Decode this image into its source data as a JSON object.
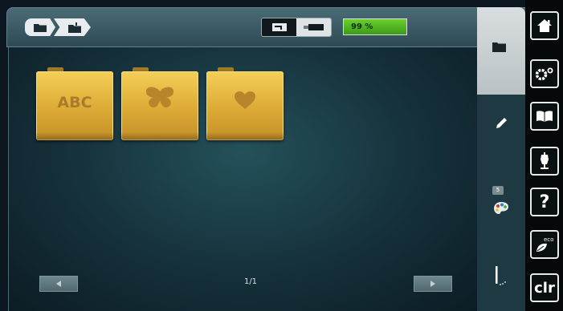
{
  "breadcrumb": {
    "root_icon": "folder-icon",
    "sub_icon": "sewing-folder-icon"
  },
  "status": {
    "mode_left_icon": "embroidery-hoop-icon",
    "mode_right_icon": "usb-stick-icon",
    "battery_text": "99 %",
    "battery_level": 0.99,
    "battery_color": "#4fb320"
  },
  "folders": [
    {
      "label": "ABC",
      "icon": "text-icon"
    },
    {
      "label": "",
      "icon": "butterfly-icon"
    },
    {
      "label": "",
      "icon": "heart-icon"
    }
  ],
  "pagination": {
    "page_text": "1/1",
    "prev_icon": "arrow-left-icon",
    "next_icon": "arrow-right-icon"
  },
  "side_tabs": [
    {
      "name": "folder",
      "icon": "folder-icon"
    },
    {
      "name": "edit",
      "icon": "pencil-icon"
    },
    {
      "name": "colors",
      "icon": "palette-icon",
      "badge": "5"
    },
    {
      "name": "stitch",
      "icon": "needle-icon"
    }
  ],
  "tools": [
    {
      "name": "home",
      "icon": "home-icon"
    },
    {
      "name": "setup",
      "icon": "gear-icon"
    },
    {
      "name": "tutorial",
      "icon": "book-icon"
    },
    {
      "name": "creative-consultant",
      "icon": "mannequin-icon"
    },
    {
      "name": "help",
      "icon": "question-icon",
      "text": "?"
    },
    {
      "name": "eco",
      "icon": "eco-leaf-icon",
      "text": "eco"
    },
    {
      "name": "clear",
      "icon": "clr-icon",
      "text": "clr"
    }
  ],
  "colors": {
    "folder_gold": "#e2b23d",
    "panel_teal": "#1e4a54",
    "accent_green": "#4fb320"
  }
}
